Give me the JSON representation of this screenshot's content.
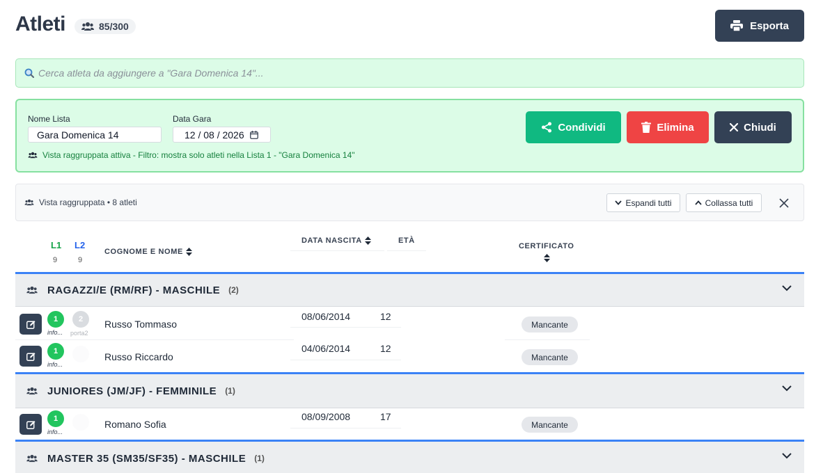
{
  "header": {
    "title": "Atleti",
    "count": "85/300",
    "export_label": "Esporta"
  },
  "search": {
    "placeholder": "Cerca atleta da aggiungere a \"Gara Domenica 14\"..."
  },
  "list_panel": {
    "name_label": "Nome Lista",
    "name_value": "Gara Domenica 14",
    "date_label": "Data Gara",
    "date_value": "12 / 08 / 2026",
    "share_label": "Condividi",
    "delete_label": "Elimina",
    "close_label": "Chiudi",
    "filter_note": "Vista raggruppata attiva - Filtro: mostra solo atleti nella Lista 1 - \"Gara Domenica 14\"",
    "colors": {
      "share": "#10b981",
      "delete": "#ef4444",
      "close": "#334155"
    }
  },
  "group_toolbar": {
    "label": "Vista raggruppata • 8 atleti",
    "expand_label": "Espandi tutti",
    "collapse_label": "Collassa tutti"
  },
  "table_header": {
    "l1": "L1",
    "l1_count": "9",
    "l2": "L2",
    "l2_count": "9",
    "name": "COGNOME E NOME",
    "birth": "DATA NASCITA",
    "age": "ETÀ",
    "certificate": "CERTIFICATO"
  },
  "groups": [
    {
      "title": "RAGAZZI/E (RM/RF) - MASCHILE",
      "count": "(2)",
      "rows": [
        {
          "l1": "1",
          "l1_note": "info...",
          "l2": "2",
          "l2_note": "porta2",
          "name": "Russo Tommaso",
          "birth": "08/06/2014",
          "age": "12",
          "cert": "Mancante"
        },
        {
          "l1": "1",
          "l1_note": "info...",
          "name": "Russo Riccardo",
          "birth": "04/06/2014",
          "age": "12",
          "cert": "Mancante"
        }
      ]
    },
    {
      "title": "JUNIORES (JM/JF) - FEMMINILE",
      "count": "(1)",
      "rows": [
        {
          "l1": "1",
          "l1_note": "info...",
          "name": "Romano Sofia",
          "birth": "08/09/2008",
          "age": "17",
          "cert": "Mancante"
        }
      ]
    },
    {
      "title": "MASTER 35 (SM35/SF35) - MASCHILE",
      "count": "(1)",
      "rows": []
    }
  ]
}
